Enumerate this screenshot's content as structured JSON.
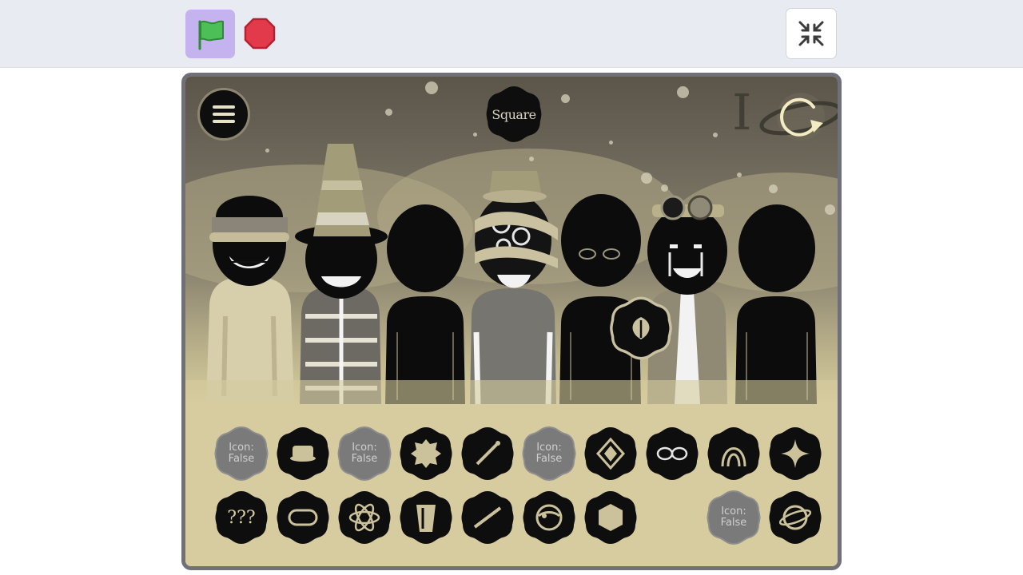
{
  "toolbar": {
    "green_flag_icon": "green-flag-icon",
    "stop_icon": "stop-sign-icon",
    "fullscreen_icon": "exit-fullscreen-icon",
    "colors": {
      "bar": "#e8ebf1",
      "flag_button": "#c4b3ee",
      "flag": "#4cbf56",
      "stop": "#e23a4b"
    }
  },
  "stage": {
    "menu_icon": "hamburger-menu-icon",
    "mode_label": "Square",
    "roman_numeral": "I",
    "reset_icon": "rotate-arrow-icon",
    "colors": {
      "frame": "#6f7078",
      "tray": "#d6cc9f",
      "badge": "#0e0e0e"
    }
  },
  "characters": [
    {
      "id": "char-1",
      "state": "active",
      "accessory": "bowler-hat"
    },
    {
      "id": "char-2",
      "state": "active",
      "accessory": "cone-hat"
    },
    {
      "id": "char-3",
      "state": "empty"
    },
    {
      "id": "char-4",
      "state": "active",
      "accessory": "bandaged-mask"
    },
    {
      "id": "char-5",
      "state": "silhouette",
      "accessory": "glasses"
    },
    {
      "id": "char-6",
      "state": "active",
      "accessory": "goggles"
    },
    {
      "id": "char-7",
      "state": "empty"
    }
  ],
  "floating_icon": {
    "name": "leaf-icon"
  },
  "tray": {
    "row1": [
      {
        "type": "text",
        "label": "Icon:\nFalse"
      },
      {
        "type": "icon",
        "icon": "hat-icon"
      },
      {
        "type": "text",
        "label": "Icon:\nFalse"
      },
      {
        "type": "icon",
        "icon": "splat-icon"
      },
      {
        "type": "icon",
        "icon": "wand-icon"
      },
      {
        "type": "text",
        "label": "Icon:\nFalse"
      },
      {
        "type": "icon",
        "icon": "diamond-icon"
      },
      {
        "type": "icon",
        "icon": "glasses-icon"
      },
      {
        "type": "icon",
        "icon": "arch-icon"
      },
      {
        "type": "icon",
        "icon": "sparkle-icon"
      }
    ],
    "row2": [
      {
        "type": "text",
        "label": "???"
      },
      {
        "type": "icon",
        "icon": "capsule-icon"
      },
      {
        "type": "icon",
        "icon": "atom-icon"
      },
      {
        "type": "icon",
        "icon": "cup-icon"
      },
      {
        "type": "icon",
        "icon": "stick-icon"
      },
      {
        "type": "icon",
        "icon": "eye-icon"
      },
      {
        "type": "icon",
        "icon": "hexagon-icon"
      },
      {
        "type": "empty"
      },
      {
        "type": "text",
        "label": "Icon:\nFalse"
      },
      {
        "type": "icon",
        "icon": "planet-icon"
      }
    ]
  }
}
